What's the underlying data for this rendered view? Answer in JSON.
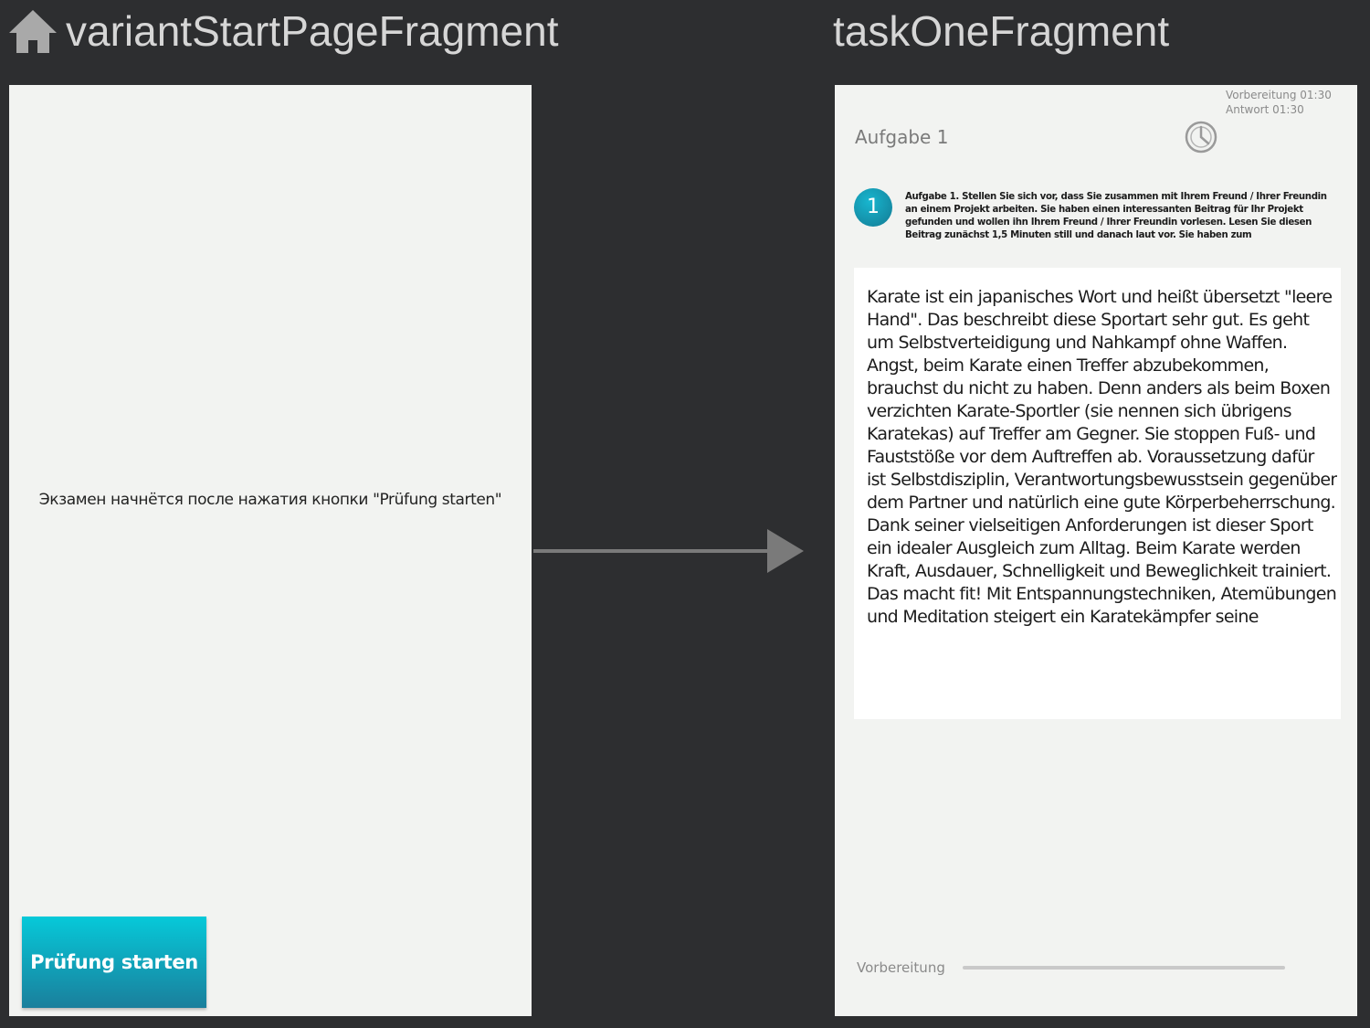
{
  "screens": {
    "start": {
      "label": "variantStartPageFragment"
    },
    "task": {
      "label": "taskOneFragment"
    }
  },
  "start_page": {
    "message": "Экзамен начнётся после нажатия кнопки \"Prüfung starten\"",
    "start_button_label": "Prüfung starten"
  },
  "task_page": {
    "timers": {
      "preparation": "Vorbereitung 01:30",
      "answer": "Antwort 01:30"
    },
    "title": "Aufgabe 1",
    "task_number": "1",
    "instruction": "Aufgabe 1. Stellen Sie sich vor, dass Sie zusammen mit Ihrem Freund / Ihrer Freundin an einem Projekt arbeiten. Sie haben einen interessanten Beitrag für Ihr Projekt gefunden und wollen ihn Ihrem Freund / Ihrer Freundin vorlesen. Lesen Sie diesen Beitrag zunächst 1,5 Minuten still und danach laut vor. Sie haben zum",
    "reading_text": "Karate ist ein japanisches Wort und heißt übersetzt \"leere Hand\". Das beschreibt diese Sportart sehr gut. Es geht um Selbstverteidigung und Nahkampf ohne Waffen.\nAngst, beim Karate einen Treffer abzubekommen, brauchst du nicht zu haben. Denn anders als beim Boxen verzichten Karate-Sportler (sie nennen sich übrigens Karatekas) auf Treffer am Gegner. Sie stoppen Fuß- und Fauststöße vor dem Auftreffen ab. Voraussetzung dafür ist Selbstdisziplin, Verantwortungsbewusstsein gegenüber dem Partner und natürlich eine gute Körperbeherrschung.\nDank seiner vielseitigen Anforderungen ist dieser Sport ein idealer Ausgleich zum Alltag. Beim Karate werden Kraft, Ausdauer, Schnelligkeit und Beweglichkeit trainiert. Das macht fit! Mit Entspannungstechniken, Atemübungen und Meditation steigert ein Karatekämpfer seine",
    "progress": {
      "label": "Vorbereitung",
      "value": 0
    }
  },
  "icons": {
    "home": "home-icon",
    "timer": "timer-icon",
    "arrow": "arrow-right-icon"
  },
  "colors": {
    "background": "#2d2e30",
    "screen": "#f2f3f1",
    "accent_top": "#06c9d9",
    "accent_bottom": "#1a7f9c",
    "arrow": "#7a7a7a"
  }
}
